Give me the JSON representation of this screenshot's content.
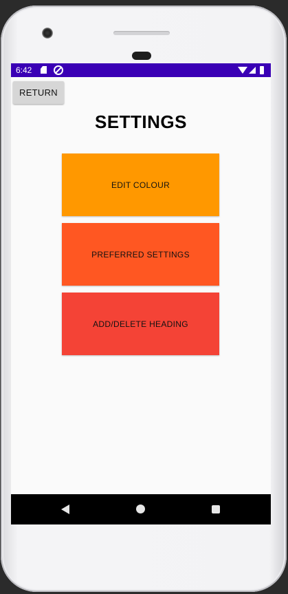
{
  "status_bar": {
    "time": "6:42",
    "icons": [
      "sd-card-icon",
      "do-not-disturb-icon",
      "wifi-icon",
      "signal-icon",
      "battery-icon"
    ]
  },
  "app": {
    "return_label": "RETURN",
    "title": "SETTINGS",
    "buttons": [
      {
        "label": "EDIT COLOUR",
        "color": "#ff9800"
      },
      {
        "label": "PREFERRED SETTINGS",
        "color": "#ff5722"
      },
      {
        "label": "ADD/DELETE HEADING",
        "color": "#f44336"
      }
    ]
  },
  "nav_bar": {
    "icons": [
      "back-icon",
      "home-icon",
      "recents-icon"
    ]
  },
  "colors": {
    "status_bar": "#3a00b5",
    "screen_background": "#fafafa",
    "return_button": "#d6d6d6"
  }
}
